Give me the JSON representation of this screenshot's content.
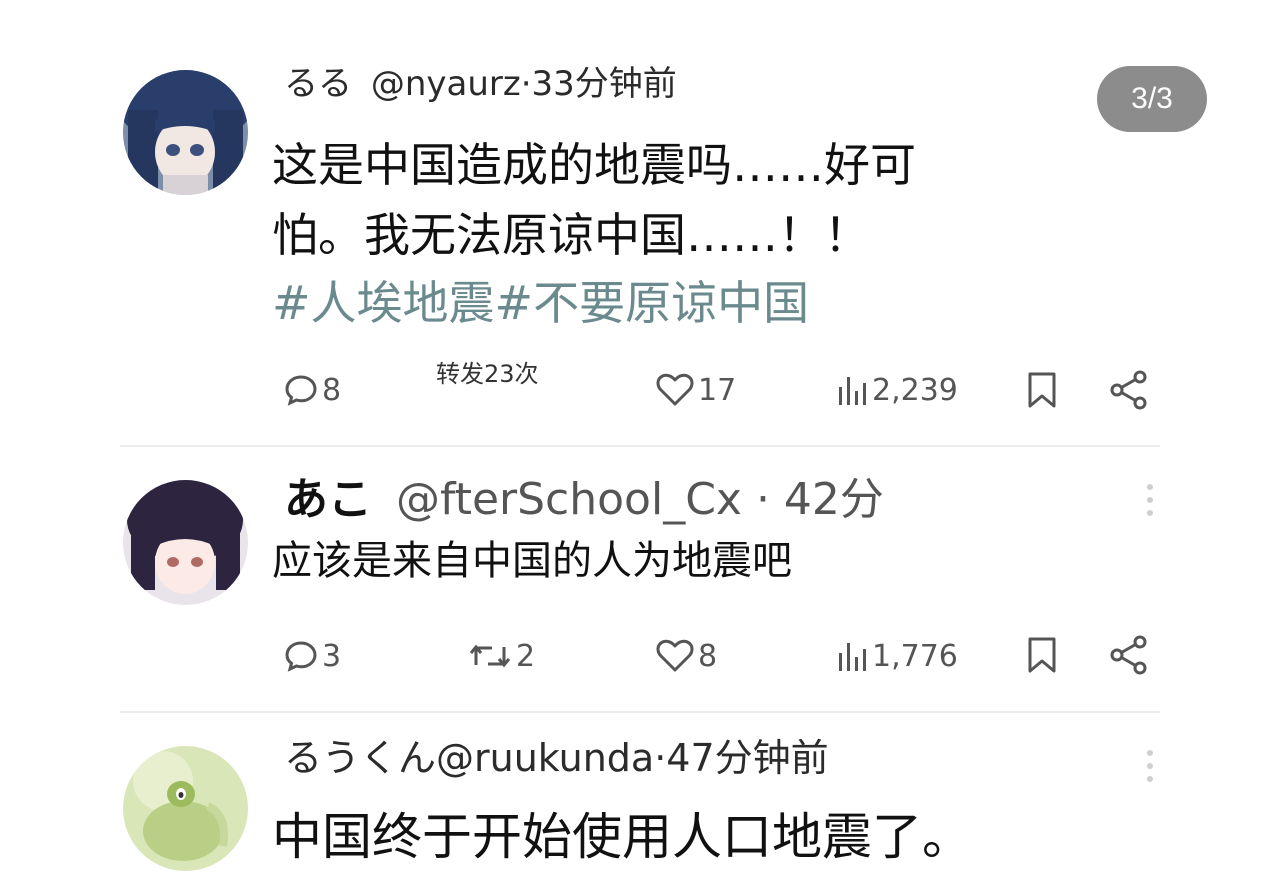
{
  "counter": "3/3",
  "posts": [
    {
      "name": "るる",
      "handle": "@nyaurz·33分钟前",
      "lines": [
        "这是中国造成的地震吗……好可",
        "怕。我无法原谅中国……！！"
      ],
      "hashtags": "#人埃地震#不要原谅中国",
      "replies": "8",
      "reposts_note": "转发23次",
      "likes": "17",
      "views": "2,239"
    },
    {
      "name": "あこ",
      "handle": "@fterSchool_Cx · 42分",
      "lines": [
        "应该是来自中国的人为地震吧"
      ],
      "replies": "3",
      "reposts": "2",
      "likes": "8",
      "views": "1,776"
    },
    {
      "name": "るうくん",
      "handle": "@ruukunda·47分钟前",
      "lines": [
        "中国终于开始使用人口地震了。"
      ]
    }
  ],
  "icons": {
    "reply": "speech-bubble-icon",
    "repost": "retweet-arrows-icon",
    "like": "heart-icon",
    "views": "bar-chart-icon",
    "bookmark": "bookmark-icon",
    "share": "share-icon",
    "more": "vertical-dots-icon"
  }
}
